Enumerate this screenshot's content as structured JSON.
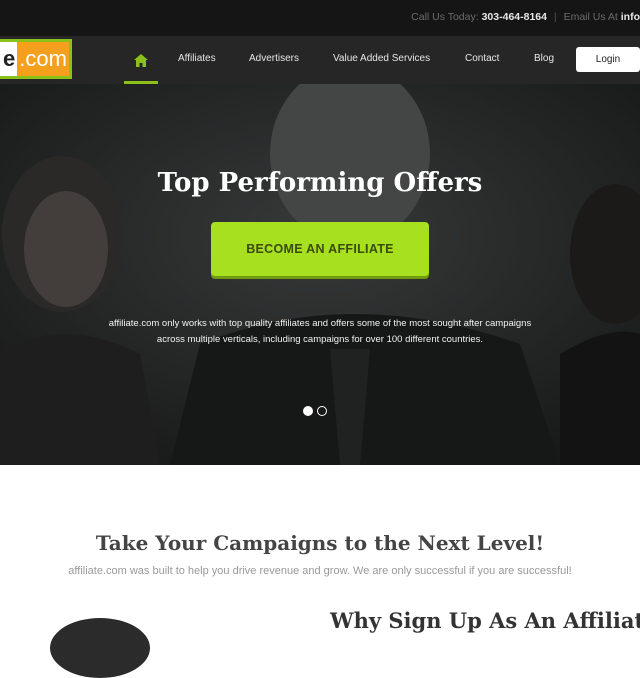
{
  "topbar": {
    "call_label": "Call Us Today:",
    "phone": "303-464-8164",
    "separator": "|",
    "email_label": "Email Us At",
    "email": "info"
  },
  "logo": {
    "text_e": "e",
    "text_com": ".com"
  },
  "nav": {
    "home_icon": "home-icon",
    "items": [
      "Affiliates",
      "Advertisers",
      "Value Added Services",
      "Contact",
      "Blog"
    ],
    "login": "Login"
  },
  "hero": {
    "title": "Top Performing Offers",
    "cta": "BECOME AN AFFILIATE",
    "description_line1": "affiliate.com only works with top quality affiliates and offers some of the most sought after campaigns",
    "description_line2": "across multiple verticals, including campaigns for over 100 different countries.",
    "slides_total": 2,
    "active_slide": 1
  },
  "section": {
    "title": "Take Your Campaigns to the Next Level!",
    "subtitle": "affiliate.com was built to help you drive revenue and grow. We are only successful if you are successful!",
    "why_title": "Why Sign Up As An Affiliate?"
  },
  "colors": {
    "accent_green": "#a6e01f",
    "logo_orange": "#f4a01c",
    "topbar_bg": "#151515",
    "nav_bg": "#262626"
  }
}
